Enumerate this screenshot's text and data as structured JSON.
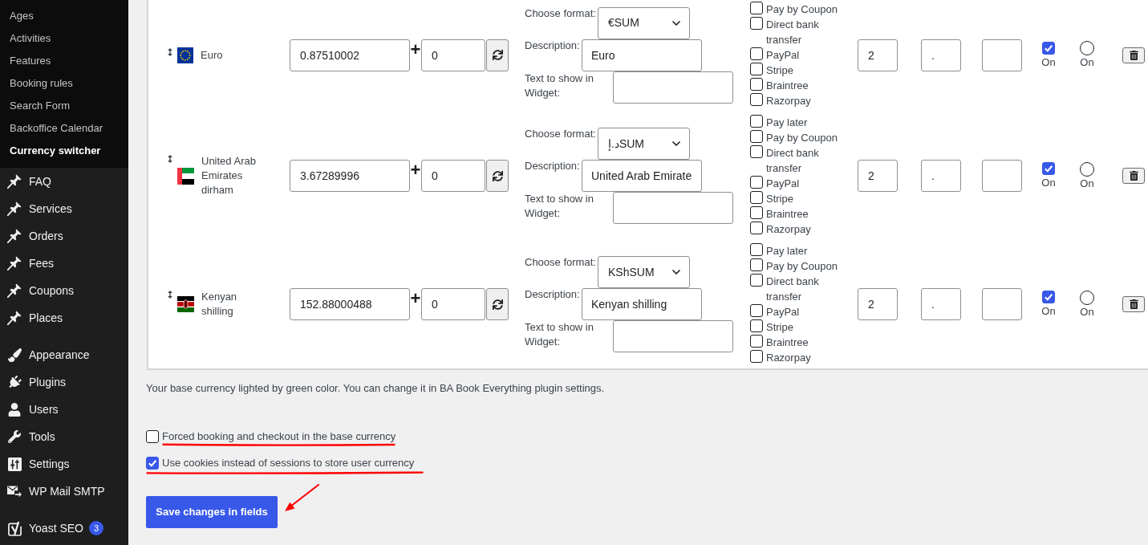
{
  "sidebar": {
    "submenu": [
      {
        "label": "Ages",
        "selected": false
      },
      {
        "label": "Activities",
        "selected": false
      },
      {
        "label": "Features",
        "selected": false
      },
      {
        "label": "Booking rules",
        "selected": false
      },
      {
        "label": "Search Form",
        "selected": false
      },
      {
        "label": "Backoffice Calendar",
        "selected": false
      },
      {
        "label": "Currency switcher",
        "selected": true
      }
    ],
    "menu_groups": [
      {
        "items": [
          {
            "label": "FAQ",
            "kind": "pin"
          },
          {
            "label": "Services",
            "kind": "pin"
          },
          {
            "label": "Orders",
            "kind": "pin"
          },
          {
            "label": "Fees",
            "kind": "pin"
          },
          {
            "label": "Coupons",
            "kind": "pin"
          },
          {
            "label": "Places",
            "kind": "pin"
          }
        ]
      },
      {
        "items": [
          {
            "label": "Appearance",
            "kind": "brush"
          },
          {
            "label": "Plugins",
            "kind": "plug"
          },
          {
            "label": "Users",
            "kind": "user"
          },
          {
            "label": "Tools",
            "kind": "wrench"
          },
          {
            "label": "Settings",
            "kind": "sliders"
          },
          {
            "label": "WP Mail SMTP",
            "kind": "mail"
          }
        ]
      },
      {
        "items": [
          {
            "label": "Yoast SEO",
            "kind": "yoast",
            "badge": "3"
          }
        ]
      }
    ]
  },
  "currencies": [
    {
      "name": "Euro",
      "field_1": "0.87510002",
      "operator": "+",
      "field_2": "0",
      "format": {
        "label": "Choose format:",
        "value": "€SUM"
      },
      "description": {
        "label": "Description:",
        "value": "Euro"
      },
      "widget_text": {
        "label": "Text to show in Widget:"
      },
      "payments": [
        {
          "label": "Pay by Coupon",
          "checked": false
        },
        {
          "label": "Direct bank transfer",
          "checked": false
        },
        {
          "label": "PayPal",
          "checked": false
        },
        {
          "label": "Stripe",
          "checked": false
        },
        {
          "label": "Braintree",
          "checked": false
        },
        {
          "label": "Razorpay",
          "checked": false
        }
      ],
      "field_3": "2",
      "field_4": ".",
      "checkbox": {
        "label": "On",
        "checked": true
      },
      "radio": {
        "label": "On",
        "selected": false
      }
    },
    {
      "name": "United Arab Emirates dirham",
      "field_1": "3.67289996",
      "operator": "+",
      "field_2": "0",
      "format": {
        "label": "Choose format:",
        "value": "د.إSUM"
      },
      "description": {
        "label": "Description:",
        "value": "United Arab Emirate"
      },
      "widget_text": {
        "label": "Text to show in Widget:"
      },
      "payments": [
        {
          "label": "Pay later",
          "checked": false
        },
        {
          "label": "Pay by Coupon",
          "checked": false
        },
        {
          "label": "Direct bank transfer",
          "checked": false
        },
        {
          "label": "PayPal",
          "checked": false
        },
        {
          "label": "Stripe",
          "checked": false
        },
        {
          "label": "Braintree",
          "checked": false
        },
        {
          "label": "Razorpay",
          "checked": false
        }
      ],
      "field_3": "2",
      "field_4": ".",
      "checkbox": {
        "label": "On",
        "checked": true
      },
      "radio": {
        "label": "On",
        "selected": false
      }
    },
    {
      "name": "Kenyan shilling",
      "field_1": "152.88000488",
      "operator": "+",
      "field_2": "0",
      "format": {
        "label": "Choose format:",
        "value": "KShSUM"
      },
      "description": {
        "label": "Description:",
        "value": "Kenyan shilling"
      },
      "widget_text": {
        "label": "Text to show in Widget:"
      },
      "payments": [
        {
          "label": "Pay later",
          "checked": false
        },
        {
          "label": "Pay by Coupon",
          "checked": false
        },
        {
          "label": "Direct bank transfer",
          "checked": false
        },
        {
          "label": "PayPal",
          "checked": false
        },
        {
          "label": "Stripe",
          "checked": false
        },
        {
          "label": "Braintree",
          "checked": false
        },
        {
          "label": "Razorpay",
          "checked": false
        }
      ],
      "field_3": "2",
      "field_4": ".",
      "checkbox": {
        "label": "On",
        "checked": true
      },
      "radio": {
        "label": "On",
        "selected": false
      }
    }
  ],
  "note": "Your base currency lighted by green color. You can change it in BA Book Everything plugin settings.",
  "options": [
    {
      "label": "Forced booking and checkout in the base currency",
      "checked": false
    },
    {
      "label": "Use cookies instead of sessions to store user currency",
      "checked": true
    }
  ],
  "save_button": "Save changes in fields"
}
